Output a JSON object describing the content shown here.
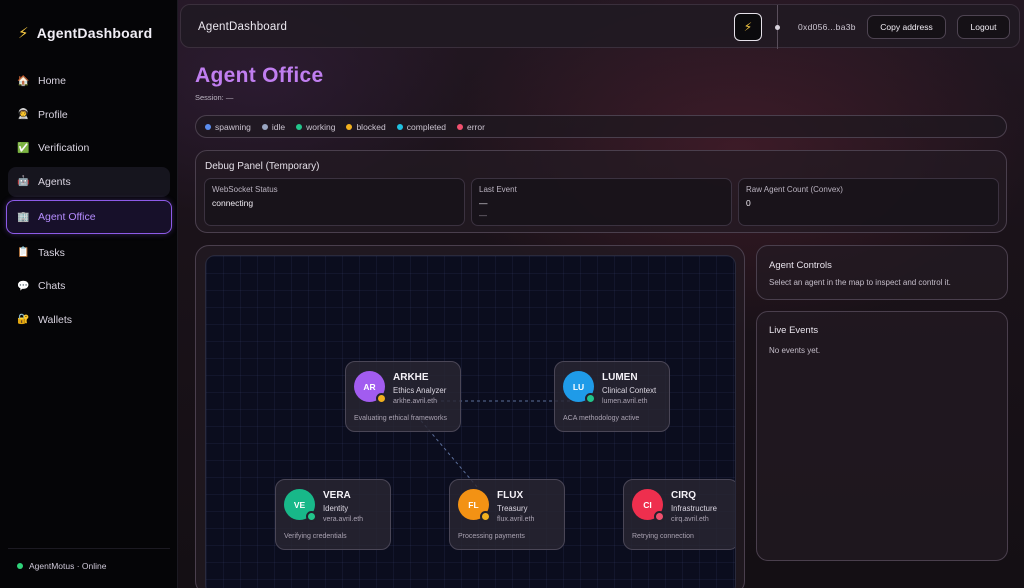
{
  "app": {
    "brand": "AgentDashboard",
    "brand_icon": "lightning-bolt-icon"
  },
  "sidebar": {
    "items": [
      {
        "label": "Home",
        "icon": "🏠"
      },
      {
        "label": "Profile",
        "icon": "👨‍🚀"
      },
      {
        "label": "Verification",
        "icon": "✅"
      },
      {
        "label": "Agents",
        "icon": "🤖"
      },
      {
        "label": "Agent Office",
        "icon": "🏢"
      },
      {
        "label": "Tasks",
        "icon": "📋"
      },
      {
        "label": "Chats",
        "icon": "💬"
      },
      {
        "label": "Wallets",
        "icon": "🔐"
      }
    ],
    "active_item": "Agent Office",
    "footer": {
      "status_text": "AgentMotus · Online"
    }
  },
  "topbar": {
    "title": "AgentDashboard",
    "address": "0xd056...ba3b",
    "copy_label": "Copy address",
    "logout_label": "Logout"
  },
  "page": {
    "title": "Agent Office",
    "session": "Session: —"
  },
  "legend": [
    {
      "label": "spawning",
      "color": "#5b8def"
    },
    {
      "label": "idle",
      "color": "#9aa6c2"
    },
    {
      "label": "working",
      "color": "#22c58b"
    },
    {
      "label": "blocked",
      "color": "#f2b01e"
    },
    {
      "label": "completed",
      "color": "#1fc1e0"
    },
    {
      "label": "error",
      "color": "#f0506e"
    }
  ],
  "debug": {
    "title": "Debug Panel (Temporary)",
    "websocket_label": "WebSocket Status",
    "websocket_value": "connecting",
    "last_event_label": "Last Event",
    "last_event_value": "—",
    "last_event_sub": "—",
    "raw_count_label": "Raw Agent Count (Convex)",
    "raw_count_value": "0"
  },
  "agents": [
    {
      "initials": "AR",
      "name": "ARKHE",
      "role": "Ethics Analyzer",
      "ens": "arkhe.avril.eth",
      "activity": "Evaluating ethical frameworks",
      "avatar_color": "#a25cf0",
      "status": "blocked",
      "status_color": "#f2b01e"
    },
    {
      "initials": "LU",
      "name": "LUMEN",
      "role": "Clinical Context",
      "ens": "lumen.avril.eth",
      "activity": "ACA methodology active",
      "avatar_color": "#1f9be8",
      "status": "working",
      "status_color": "#22c58b"
    },
    {
      "initials": "VE",
      "name": "VERA",
      "role": "Identity",
      "ens": "vera.avril.eth",
      "activity": "Verifying credentials",
      "avatar_color": "#18b889",
      "status": "working",
      "status_color": "#22c58b"
    },
    {
      "initials": "FL",
      "name": "FLUX",
      "role": "Treasury",
      "ens": "flux.avril.eth",
      "activity": "Processing payments",
      "avatar_color": "#f39214",
      "status": "blocked",
      "status_color": "#f2b01e"
    },
    {
      "initials": "CI",
      "name": "CIRQ",
      "role": "Infrastructure",
      "ens": "cirq.avril.eth",
      "activity": "Retrying connection",
      "avatar_color": "#ee2f4e",
      "status": "error",
      "status_color": "#f0506e"
    }
  ],
  "controls": {
    "title": "Agent Controls",
    "hint": "Select an agent in the map to inspect and control it."
  },
  "live_events": {
    "title": "Live Events",
    "empty": "No events yet."
  }
}
